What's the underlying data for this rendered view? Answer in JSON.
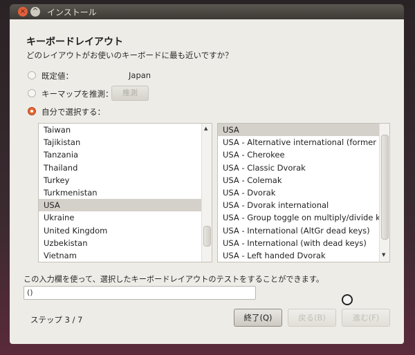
{
  "window": {
    "title": "インストール",
    "close_glyph": "×",
    "minimize_glyph": "^"
  },
  "page": {
    "heading": "キーボードレイアウト",
    "question": "どのレイアウトがお使いのキーボードに最も近いですか？"
  },
  "options": {
    "default_label": "既定値：",
    "default_value": "Japan",
    "detect_label": "キーマップを推測：",
    "detect_button": "推測",
    "manual_label": "自分で選択する：",
    "selected_option": "manual"
  },
  "countries": {
    "items": [
      "Taiwan",
      "Tajikistan",
      "Tanzania",
      "Thailand",
      "Turkey",
      "Turkmenistan",
      "USA",
      "Ukraine",
      "United Kingdom",
      "Uzbekistan",
      "Vietnam"
    ],
    "selected": "USA"
  },
  "layouts": {
    "items": [
      "USA",
      "USA - Alternative international (former us_intl)",
      "USA - Cherokee",
      "USA - Classic Dvorak",
      "USA - Colemak",
      "USA - Dvorak",
      "USA - Dvorak international",
      "USA - Group toggle on multiply/divide key",
      "USA - International (AltGr dead keys)",
      "USA - International (with dead keys)",
      "USA - Left handed Dvorak"
    ],
    "selected": "USA"
  },
  "test": {
    "hint": "この入力欄を使って、選択したキーボードレイアウトのテストをすることができます。",
    "value": "()"
  },
  "footer": {
    "step": "ステップ 3 / 7",
    "quit_button": "終了(Q)",
    "back_button": "戻る(B)",
    "forward_button": "進む(F)"
  },
  "colors": {
    "accent": "#e8662f",
    "window_bg": "#eeece7",
    "selection": "#d4d0ca"
  }
}
